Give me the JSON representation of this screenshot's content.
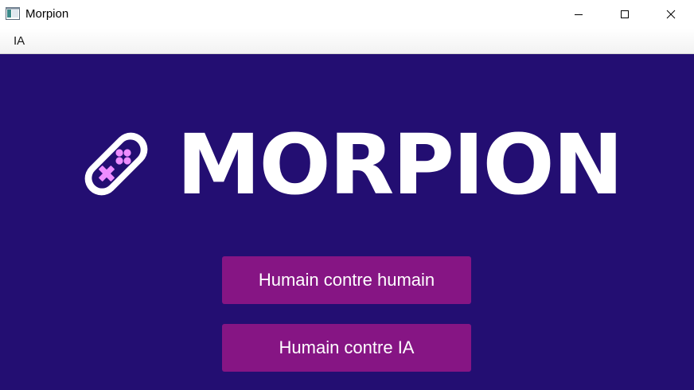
{
  "window": {
    "title": "Morpion",
    "icon": "app-window-icon",
    "controls": [
      "minimize-icon",
      "maximize-icon",
      "close-icon"
    ]
  },
  "menubar": {
    "items": [
      {
        "label": "IA"
      }
    ]
  },
  "main": {
    "logo_text": "MORPION",
    "logo_icon": "gamepad-icon",
    "buttons": [
      {
        "label": "Humain contre humain"
      },
      {
        "label": "Humain contre IA"
      }
    ]
  },
  "colors": {
    "background": "#230e72",
    "button": "#861584",
    "logo_accent": "#ee8cff"
  }
}
